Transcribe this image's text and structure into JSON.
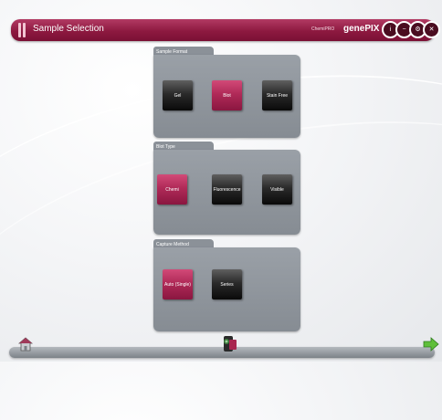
{
  "window": {
    "title": "Sample Selection",
    "brand_small": "ChemiPRO",
    "brand_main": "genePIX",
    "buttons": [
      {
        "name": "info-button",
        "icon": "info-icon",
        "glyph": "i"
      },
      {
        "name": "minimize-button",
        "icon": "minus-icon",
        "glyph": "−"
      },
      {
        "name": "settings-button",
        "icon": "gear-icon",
        "glyph": "⚙"
      },
      {
        "name": "close-button",
        "icon": "close-icon",
        "glyph": "✕"
      }
    ]
  },
  "sample_format": {
    "title": "Sample Format",
    "options": [
      {
        "label": "Gel",
        "selected": false
      },
      {
        "label": "Blot",
        "selected": true
      },
      {
        "label": "Stain Free",
        "selected": false
      }
    ]
  },
  "blot_type": {
    "title": "Blot Type",
    "options": [
      {
        "label": "Chemi",
        "selected": true
      },
      {
        "label": "Fluorescence",
        "selected": false
      },
      {
        "label": "Visible",
        "selected": false
      }
    ]
  },
  "capture_method": {
    "title": "Capture Method",
    "options": [
      {
        "label": "Auto (Single)",
        "selected": true
      },
      {
        "label": "Series",
        "selected": false
      }
    ]
  },
  "footer": {
    "home_icon": "home-icon",
    "camera_icon": "camera-icon",
    "next_icon": "next-arrow-icon"
  },
  "colors": {
    "accent": "#9c1f4a",
    "selected": "#b02a58",
    "panel": "#8f959c"
  }
}
